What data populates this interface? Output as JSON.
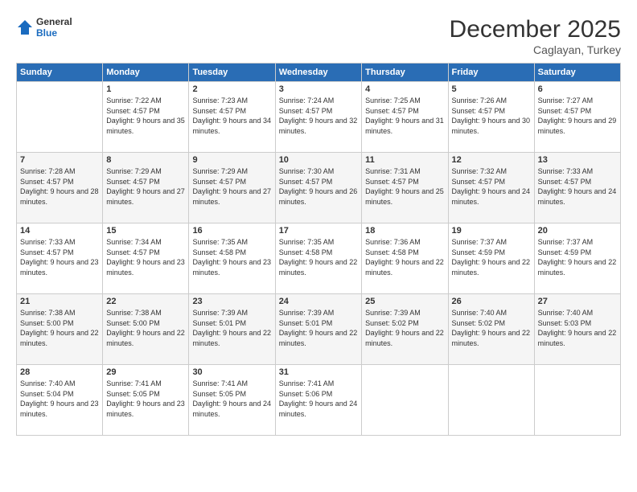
{
  "logo": {
    "general": "General",
    "blue": "Blue"
  },
  "title": "December 2025",
  "subtitle": "Caglayan, Turkey",
  "days_header": [
    "Sunday",
    "Monday",
    "Tuesday",
    "Wednesday",
    "Thursday",
    "Friday",
    "Saturday"
  ],
  "weeks": [
    [
      {
        "day": "",
        "sunrise": "",
        "sunset": "",
        "daylight": ""
      },
      {
        "day": "1",
        "sunrise": "Sunrise: 7:22 AM",
        "sunset": "Sunset: 4:57 PM",
        "daylight": "Daylight: 9 hours and 35 minutes."
      },
      {
        "day": "2",
        "sunrise": "Sunrise: 7:23 AM",
        "sunset": "Sunset: 4:57 PM",
        "daylight": "Daylight: 9 hours and 34 minutes."
      },
      {
        "day": "3",
        "sunrise": "Sunrise: 7:24 AM",
        "sunset": "Sunset: 4:57 PM",
        "daylight": "Daylight: 9 hours and 32 minutes."
      },
      {
        "day": "4",
        "sunrise": "Sunrise: 7:25 AM",
        "sunset": "Sunset: 4:57 PM",
        "daylight": "Daylight: 9 hours and 31 minutes."
      },
      {
        "day": "5",
        "sunrise": "Sunrise: 7:26 AM",
        "sunset": "Sunset: 4:57 PM",
        "daylight": "Daylight: 9 hours and 30 minutes."
      },
      {
        "day": "6",
        "sunrise": "Sunrise: 7:27 AM",
        "sunset": "Sunset: 4:57 PM",
        "daylight": "Daylight: 9 hours and 29 minutes."
      }
    ],
    [
      {
        "day": "7",
        "sunrise": "Sunrise: 7:28 AM",
        "sunset": "Sunset: 4:57 PM",
        "daylight": "Daylight: 9 hours and 28 minutes."
      },
      {
        "day": "8",
        "sunrise": "Sunrise: 7:29 AM",
        "sunset": "Sunset: 4:57 PM",
        "daylight": "Daylight: 9 hours and 27 minutes."
      },
      {
        "day": "9",
        "sunrise": "Sunrise: 7:29 AM",
        "sunset": "Sunset: 4:57 PM",
        "daylight": "Daylight: 9 hours and 27 minutes."
      },
      {
        "day": "10",
        "sunrise": "Sunrise: 7:30 AM",
        "sunset": "Sunset: 4:57 PM",
        "daylight": "Daylight: 9 hours and 26 minutes."
      },
      {
        "day": "11",
        "sunrise": "Sunrise: 7:31 AM",
        "sunset": "Sunset: 4:57 PM",
        "daylight": "Daylight: 9 hours and 25 minutes."
      },
      {
        "day": "12",
        "sunrise": "Sunrise: 7:32 AM",
        "sunset": "Sunset: 4:57 PM",
        "daylight": "Daylight: 9 hours and 24 minutes."
      },
      {
        "day": "13",
        "sunrise": "Sunrise: 7:33 AM",
        "sunset": "Sunset: 4:57 PM",
        "daylight": "Daylight: 9 hours and 24 minutes."
      }
    ],
    [
      {
        "day": "14",
        "sunrise": "Sunrise: 7:33 AM",
        "sunset": "Sunset: 4:57 PM",
        "daylight": "Daylight: 9 hours and 23 minutes."
      },
      {
        "day": "15",
        "sunrise": "Sunrise: 7:34 AM",
        "sunset": "Sunset: 4:57 PM",
        "daylight": "Daylight: 9 hours and 23 minutes."
      },
      {
        "day": "16",
        "sunrise": "Sunrise: 7:35 AM",
        "sunset": "Sunset: 4:58 PM",
        "daylight": "Daylight: 9 hours and 23 minutes."
      },
      {
        "day": "17",
        "sunrise": "Sunrise: 7:35 AM",
        "sunset": "Sunset: 4:58 PM",
        "daylight": "Daylight: 9 hours and 22 minutes."
      },
      {
        "day": "18",
        "sunrise": "Sunrise: 7:36 AM",
        "sunset": "Sunset: 4:58 PM",
        "daylight": "Daylight: 9 hours and 22 minutes."
      },
      {
        "day": "19",
        "sunrise": "Sunrise: 7:37 AM",
        "sunset": "Sunset: 4:59 PM",
        "daylight": "Daylight: 9 hours and 22 minutes."
      },
      {
        "day": "20",
        "sunrise": "Sunrise: 7:37 AM",
        "sunset": "Sunset: 4:59 PM",
        "daylight": "Daylight: 9 hours and 22 minutes."
      }
    ],
    [
      {
        "day": "21",
        "sunrise": "Sunrise: 7:38 AM",
        "sunset": "Sunset: 5:00 PM",
        "daylight": "Daylight: 9 hours and 22 minutes."
      },
      {
        "day": "22",
        "sunrise": "Sunrise: 7:38 AM",
        "sunset": "Sunset: 5:00 PM",
        "daylight": "Daylight: 9 hours and 22 minutes."
      },
      {
        "day": "23",
        "sunrise": "Sunrise: 7:39 AM",
        "sunset": "Sunset: 5:01 PM",
        "daylight": "Daylight: 9 hours and 22 minutes."
      },
      {
        "day": "24",
        "sunrise": "Sunrise: 7:39 AM",
        "sunset": "Sunset: 5:01 PM",
        "daylight": "Daylight: 9 hours and 22 minutes."
      },
      {
        "day": "25",
        "sunrise": "Sunrise: 7:39 AM",
        "sunset": "Sunset: 5:02 PM",
        "daylight": "Daylight: 9 hours and 22 minutes."
      },
      {
        "day": "26",
        "sunrise": "Sunrise: 7:40 AM",
        "sunset": "Sunset: 5:02 PM",
        "daylight": "Daylight: 9 hours and 22 minutes."
      },
      {
        "day": "27",
        "sunrise": "Sunrise: 7:40 AM",
        "sunset": "Sunset: 5:03 PM",
        "daylight": "Daylight: 9 hours and 22 minutes."
      }
    ],
    [
      {
        "day": "28",
        "sunrise": "Sunrise: 7:40 AM",
        "sunset": "Sunset: 5:04 PM",
        "daylight": "Daylight: 9 hours and 23 minutes."
      },
      {
        "day": "29",
        "sunrise": "Sunrise: 7:41 AM",
        "sunset": "Sunset: 5:05 PM",
        "daylight": "Daylight: 9 hours and 23 minutes."
      },
      {
        "day": "30",
        "sunrise": "Sunrise: 7:41 AM",
        "sunset": "Sunset: 5:05 PM",
        "daylight": "Daylight: 9 hours and 24 minutes."
      },
      {
        "day": "31",
        "sunrise": "Sunrise: 7:41 AM",
        "sunset": "Sunset: 5:06 PM",
        "daylight": "Daylight: 9 hours and 24 minutes."
      },
      {
        "day": "",
        "sunrise": "",
        "sunset": "",
        "daylight": ""
      },
      {
        "day": "",
        "sunrise": "",
        "sunset": "",
        "daylight": ""
      },
      {
        "day": "",
        "sunrise": "",
        "sunset": "",
        "daylight": ""
      }
    ]
  ]
}
